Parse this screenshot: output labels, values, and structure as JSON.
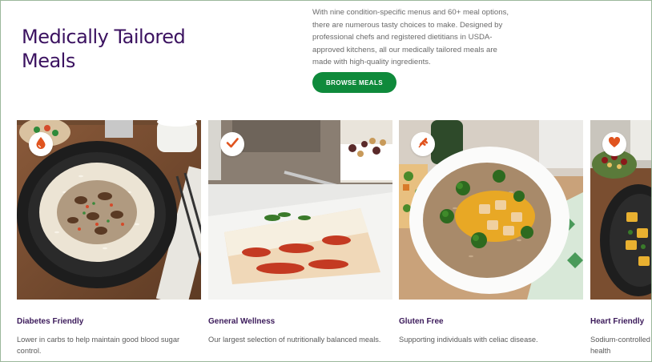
{
  "header": {
    "title_line1": "Medically Tailored",
    "title_line2": "Meals",
    "intro": "With nine condition-specific menus and 60+ meal options, there are numerous tasty choices to make. Designed by professional chefs and registered dietitians in USDA-approved kitchens, all our medically tailored meals are made with high-quality ingredients.",
    "cta_label": "BROWSE MEALS"
  },
  "colors": {
    "heading": "#3b1260",
    "cta": "#0f8a3b",
    "badge_icon": "#e0541f"
  },
  "cards": [
    {
      "title": "Diabetes Friendly",
      "desc": "Lower in carbs to help maintain good blood sugar control.",
      "icon": "blood-drop-icon"
    },
    {
      "title": "General Wellness",
      "desc": "Our largest selection of nutritionally balanced meals.",
      "icon": "checkmark-icon"
    },
    {
      "title": "Gluten Free",
      "desc": "Supporting individuals with celiac disease.",
      "icon": "wheat-icon"
    },
    {
      "title": "Heart Friendly",
      "desc_line1": "Sodium-controlled",
      "desc_line2": "health",
      "icon": "heart-icon"
    }
  ]
}
